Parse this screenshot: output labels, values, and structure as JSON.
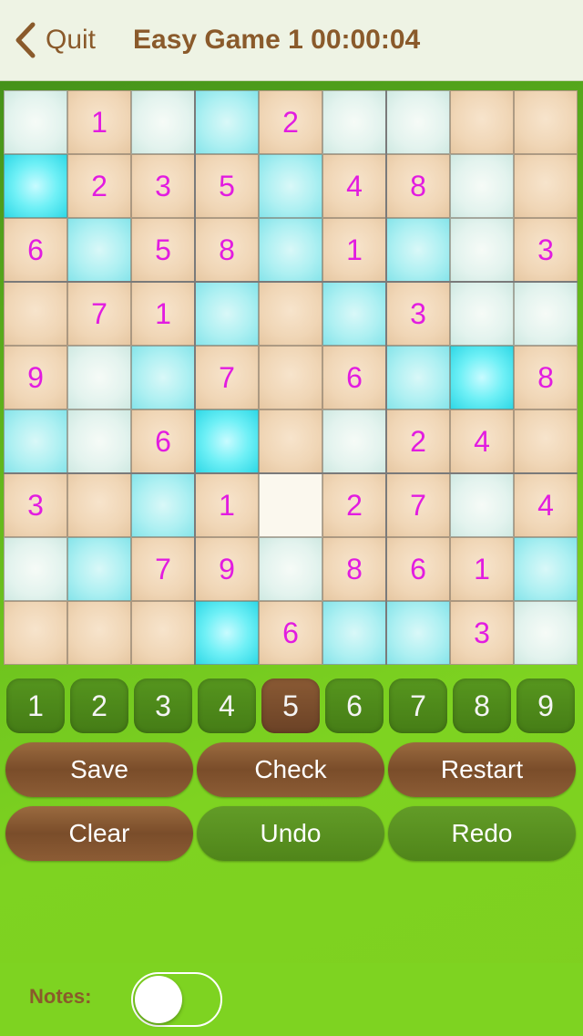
{
  "header": {
    "back_label": "Quit",
    "title": "Easy Game 1 00:00:04"
  },
  "board": {
    "values": [
      [
        "",
        "1",
        "",
        "",
        "2",
        "",
        "",
        "",
        ""
      ],
      [
        "",
        "2",
        "3",
        "5",
        "",
        "4",
        "8",
        "",
        ""
      ],
      [
        "6",
        "",
        "5",
        "8",
        "",
        "1",
        "",
        "",
        "3"
      ],
      [
        "",
        "7",
        "1",
        "",
        "",
        "",
        "3",
        "",
        ""
      ],
      [
        "9",
        "",
        "",
        "7",
        "",
        "6",
        "",
        "",
        "8"
      ],
      [
        "",
        "",
        "6",
        "",
        "",
        "",
        "2",
        "4",
        ""
      ],
      [
        "3",
        "",
        "",
        "1",
        "",
        "2",
        "7",
        "",
        "4"
      ],
      [
        "",
        "",
        "7",
        "9",
        "",
        "8",
        "6",
        "1",
        ""
      ],
      [
        "",
        "",
        "",
        "",
        "6",
        "",
        "",
        "3",
        ""
      ]
    ],
    "tiles": [
      [
        "pale",
        "sand",
        "pale",
        "aqua",
        "sand",
        "pale",
        "pale",
        "sand",
        "sand"
      ],
      [
        "cyan",
        "sand",
        "sand",
        "sand",
        "aqua",
        "sand",
        "sand",
        "pale",
        "sand"
      ],
      [
        "sand",
        "aqua",
        "sand",
        "sand",
        "aqua",
        "sand",
        "aqua",
        "pale",
        "sand"
      ],
      [
        "sand",
        "sand",
        "sand",
        "aqua",
        "sand",
        "aqua",
        "sand",
        "pale",
        "pale"
      ],
      [
        "sand",
        "pale",
        "aqua",
        "sand",
        "sand",
        "sand",
        "aqua",
        "cyan",
        "sand"
      ],
      [
        "aqua",
        "pale",
        "sand",
        "cyan",
        "sand",
        "pale",
        "sand",
        "sand",
        "sand"
      ],
      [
        "sand",
        "sand",
        "aqua",
        "sand",
        "sel",
        "sand",
        "sand",
        "pale",
        "sand"
      ],
      [
        "pale",
        "aqua",
        "sand",
        "sand",
        "pale",
        "sand",
        "sand",
        "sand",
        "aqua"
      ],
      [
        "sand",
        "sand",
        "sand",
        "cyan",
        "sand",
        "aqua",
        "aqua",
        "sand",
        "pale"
      ]
    ],
    "digit_color": "#e21ce0"
  },
  "numpad": {
    "keys": [
      "1",
      "2",
      "3",
      "4",
      "5",
      "6",
      "7",
      "8",
      "9"
    ],
    "active": "5"
  },
  "actions": [
    {
      "label": "Save",
      "style": "wood"
    },
    {
      "label": "Check",
      "style": "wood"
    },
    {
      "label": "Restart",
      "style": "wood"
    },
    {
      "label": "Clear",
      "style": "wood"
    },
    {
      "label": "Undo",
      "style": "grass"
    },
    {
      "label": "Redo",
      "style": "grass"
    }
  ],
  "footer": {
    "notes_label": "Notes:",
    "notes_on": false
  },
  "colors": {
    "brown_text": "#8a5a2b",
    "accent_green": "#7ed321"
  },
  "icons": {
    "back": "chevron-left-icon"
  }
}
